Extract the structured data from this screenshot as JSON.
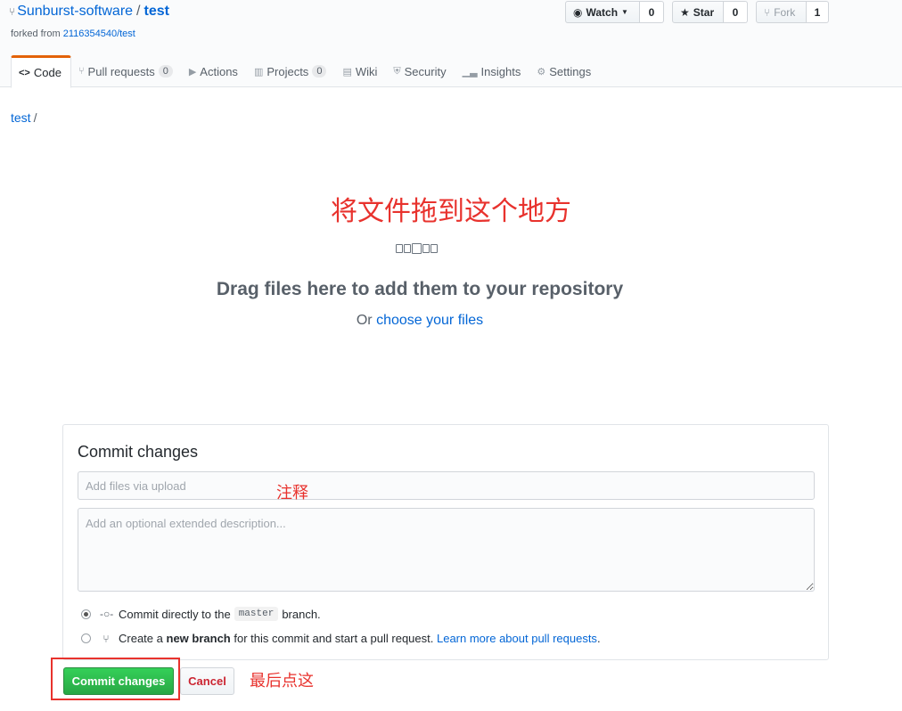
{
  "repo": {
    "owner": "Sunburst-software",
    "separator": "/",
    "name": "test",
    "forked_prefix": "forked from",
    "forked_source": "2116354540/test"
  },
  "actions": {
    "watch_label": "Watch",
    "watch_count": "0",
    "star_label": "Star",
    "star_count": "0",
    "fork_label": "Fork",
    "fork_count": "1"
  },
  "tabs": [
    {
      "label": "Code",
      "icon": "code-icon",
      "selected": true
    },
    {
      "label": "Pull requests",
      "icon": "pull-request-icon",
      "counter": "0"
    },
    {
      "label": "Actions",
      "icon": "play-icon"
    },
    {
      "label": "Projects",
      "icon": "project-icon",
      "counter": "0"
    },
    {
      "label": "Wiki",
      "icon": "book-icon"
    },
    {
      "label": "Security",
      "icon": "shield-icon"
    },
    {
      "label": "Insights",
      "icon": "graph-icon"
    },
    {
      "label": "Settings",
      "icon": "gear-icon"
    }
  ],
  "breadcrumb": {
    "repo_link": "test",
    "separator": "/"
  },
  "annotations": {
    "drop_hint": "将文件拖到这个地方",
    "summary_hint": "注释",
    "commit_hint": "最后点这"
  },
  "upload": {
    "title": "Drag files here to add them to your repository",
    "or_text": "Or",
    "choose_link": "choose your files"
  },
  "commit": {
    "title": "Commit changes",
    "summary_placeholder": "Add files via upload",
    "description_placeholder": "Add an optional extended description...",
    "option_direct_prefix": "Commit directly to the",
    "branch_name": "master",
    "option_direct_suffix": "branch.",
    "option_new_prefix": "Create a",
    "option_new_bold": "new branch",
    "option_new_suffix": "for this commit and start a pull request.",
    "learn_more": "Learn more about pull requests",
    "learn_more_suffix": ".",
    "commit_button": "Commit changes",
    "cancel_button": "Cancel"
  },
  "colors": {
    "link": "#0366d6",
    "annotation_red": "#e8322d",
    "commit_green": "#28a745",
    "tab_accent": "#e36209"
  }
}
